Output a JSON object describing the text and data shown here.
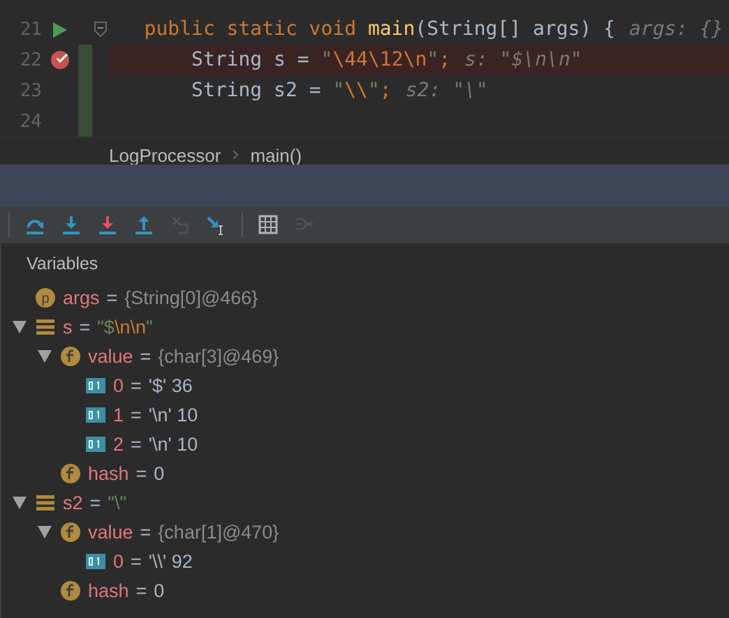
{
  "editor": {
    "lines": [
      {
        "number": "21",
        "kind": "method-header",
        "fold": true,
        "highlighted": false,
        "changed": false,
        "tokens": [
          {
            "kind": "keyword",
            "text": "public static void "
          },
          {
            "kind": "method",
            "text": "main"
          },
          {
            "kind": "plain",
            "text": "(String[] args) {"
          },
          {
            "kind": "hint",
            "text": "args: {}"
          }
        ]
      },
      {
        "number": "22",
        "kind": "breakpoint-statement",
        "fold": false,
        "highlighted": true,
        "changed": true,
        "tokens": [
          {
            "kind": "plain",
            "text": "String "
          },
          {
            "kind": "local",
            "text": "s"
          },
          {
            "kind": "plain",
            "text": " = "
          },
          {
            "kind": "string",
            "text": "\""
          },
          {
            "kind": "escape",
            "text": "\\44\\12\\n"
          },
          {
            "kind": "string",
            "text": "\""
          },
          {
            "kind": "keyword",
            "text": ";"
          },
          {
            "kind": "hint",
            "text": "s: \"$\\n\\n\""
          }
        ]
      },
      {
        "number": "23",
        "kind": "statement",
        "fold": false,
        "highlighted": false,
        "changed": true,
        "tokens": [
          {
            "kind": "plain",
            "text": "String "
          },
          {
            "kind": "local",
            "text": "s2"
          },
          {
            "kind": "plain",
            "text": " = "
          },
          {
            "kind": "string",
            "text": "\""
          },
          {
            "kind": "escape",
            "text": "\\\\"
          },
          {
            "kind": "string",
            "text": "\""
          },
          {
            "kind": "keyword",
            "text": ";"
          },
          {
            "kind": "hint",
            "text": "s2: \"\\\""
          }
        ]
      },
      {
        "number": "24",
        "kind": "blank",
        "fold": false,
        "highlighted": false,
        "changed": true
      }
    ],
    "breadcrumbs": [
      "LogProcessor",
      "main()"
    ]
  },
  "toolbar": [
    {
      "kind": "step-over",
      "disabled": false
    },
    {
      "kind": "step-into",
      "disabled": false
    },
    {
      "kind": "force-step-into",
      "disabled": false
    },
    {
      "kind": "step-out",
      "disabled": false
    },
    {
      "kind": "drop-frame",
      "disabled": true
    },
    {
      "kind": "run-to-cursor",
      "disabled": false
    },
    {
      "kind": "separator"
    },
    {
      "kind": "evaluate",
      "disabled": false
    },
    {
      "kind": "trace",
      "disabled": true
    }
  ],
  "variables": {
    "title": "Variables",
    "nodes": [
      {
        "kind": "parameter",
        "badge": "p",
        "name": "args",
        "value": [
          {
            "kind": "operator",
            "text": "="
          },
          {
            "kind": "ref",
            "text": "{String[0]@466}"
          }
        ]
      },
      {
        "kind": "local",
        "name": "s",
        "expanded": true,
        "value": [
          {
            "kind": "operator",
            "text": "="
          },
          {
            "kind": "string",
            "text": "\"$"
          },
          {
            "kind": "escape",
            "text": "\\n\\n"
          },
          {
            "kind": "string",
            "text": "\""
          }
        ],
        "children": [
          {
            "kind": "field",
            "name": "value",
            "expanded": true,
            "value": [
              {
                "kind": "operator",
                "text": "="
              },
              {
                "kind": "ref",
                "text": "{char[3]@469}"
              }
            ],
            "children": [
              {
                "kind": "element",
                "name": "0",
                "value": [
                  {
                    "kind": "operator",
                    "text": "="
                  },
                  {
                    "kind": "plain",
                    "text": "'$' 36"
                  }
                ]
              },
              {
                "kind": "element",
                "name": "1",
                "value": [
                  {
                    "kind": "operator",
                    "text": "="
                  },
                  {
                    "kind": "plain",
                    "text": "'\\n' 10"
                  }
                ]
              },
              {
                "kind": "element",
                "name": "2",
                "value": [
                  {
                    "kind": "operator",
                    "text": "="
                  },
                  {
                    "kind": "plain",
                    "text": "'\\n' 10"
                  }
                ]
              }
            ]
          },
          {
            "kind": "field",
            "name": "hash",
            "value": [
              {
                "kind": "operator",
                "text": "="
              },
              {
                "kind": "plain",
                "text": "0"
              }
            ]
          }
        ]
      },
      {
        "kind": "local",
        "name": "s2",
        "expanded": true,
        "value": [
          {
            "kind": "operator",
            "text": "="
          },
          {
            "kind": "string",
            "text": "\"\\\""
          }
        ],
        "children": [
          {
            "kind": "field",
            "name": "value",
            "expanded": true,
            "value": [
              {
                "kind": "operator",
                "text": "="
              },
              {
                "kind": "ref",
                "text": "{char[1]@470}"
              }
            ],
            "children": [
              {
                "kind": "element",
                "name": "0",
                "value": [
                  {
                    "kind": "operator",
                    "text": "="
                  },
                  {
                    "kind": "plain",
                    "text": "'\\\\' 92"
                  }
                ]
              }
            ]
          },
          {
            "kind": "field",
            "name": "hash",
            "value": [
              {
                "kind": "operator",
                "text": "="
              },
              {
                "kind": "plain",
                "text": "0"
              }
            ]
          }
        ]
      }
    ]
  }
}
